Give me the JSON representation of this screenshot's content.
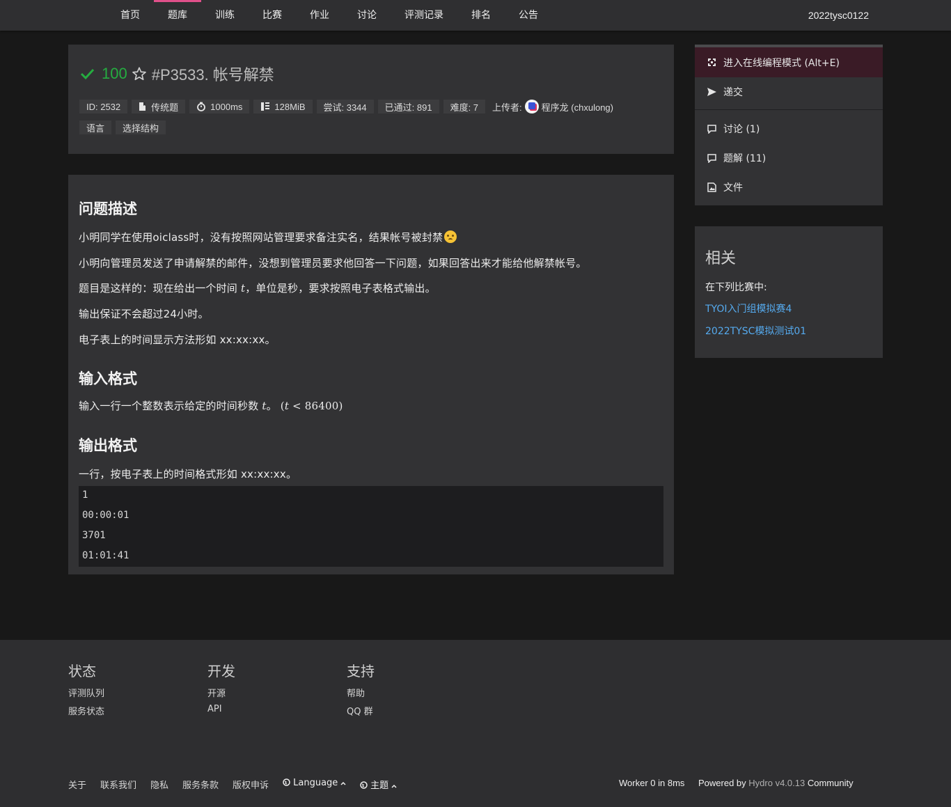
{
  "nav": {
    "items": [
      "首页",
      "题库",
      "训练",
      "比赛",
      "作业",
      "讨论",
      "评测记录",
      "排名",
      "公告"
    ],
    "active": "题库",
    "user": "2022tysc0122"
  },
  "problem": {
    "score": "100",
    "title": "#P3533. 帐号解禁",
    "meta": {
      "id": "ID: 2532",
      "type": "传统题",
      "time": "1000ms",
      "memory": "128MiB",
      "tried": "尝试: 3344",
      "passed": "已通过: 891",
      "difficulty": "难度: 7",
      "uploader_label": "上传者:",
      "uploader": "程序龙 (chxulong)"
    },
    "tags": [
      "语言",
      "选择结构"
    ]
  },
  "content": {
    "desc_heading": "问题描述",
    "desc_1": "小明同学在使用oiclass时，没有按照网站管理要求备注实名，结果帐号被封禁",
    "desc_2": "小明向管理员发送了申请解禁的邮件，没想到管理员要求他回答一下问题，如果回答出来才能给他解禁帐号。",
    "desc_3a": "题目是这样的：现在给出一个时间 ",
    "desc_3_var": "t",
    "desc_3b": "，单位是秒，要求按照电子表格式输出。",
    "desc_4": "输出保证不会超过24小时。",
    "desc_5": "电子表上的时间显示方法形如 xx:xx:xx。",
    "input_heading": "输入格式",
    "input_1a": "输入一行一个整数表示给定的时间秒数 ",
    "input_1_var": "t",
    "input_1b": "。",
    "input_math_open": "(",
    "input_math_var": "t",
    "input_math_rest": " < 86400)",
    "output_heading": "输出格式",
    "output_1": "一行，按电子表上的时间格式形如 xx:xx:xx。",
    "samples": [
      "1",
      "00:00:01",
      "3701",
      "01:01:41"
    ]
  },
  "sidebar": {
    "online_ide": "进入在线编程模式 (Alt+E)",
    "submit": "递交",
    "discuss": "讨论 (1)",
    "solutions": "题解 (11)",
    "files": "文件"
  },
  "related": {
    "title": "相关",
    "subtitle": "在下列比赛中:",
    "contests": [
      "TYOI入门组模拟赛4",
      "2022TYSC模拟测试01"
    ]
  },
  "footer": {
    "status_heading": "状态",
    "status_links": [
      "评测队列",
      "服务状态"
    ],
    "dev_heading": "开发",
    "dev_links": [
      "开源",
      "API"
    ],
    "support_heading": "支持",
    "support_links": [
      "帮助",
      "QQ 群"
    ],
    "bottom_links": [
      "关于",
      "联系我们",
      "隐私",
      "服务条款",
      "版权申诉"
    ],
    "language": "Language",
    "theme": "主题",
    "worker": "Worker 0 in 8ms",
    "powered_prefix": "Powered by",
    "powered_name": "Hydro v4.0.13",
    "powered_suffix": "Community"
  }
}
